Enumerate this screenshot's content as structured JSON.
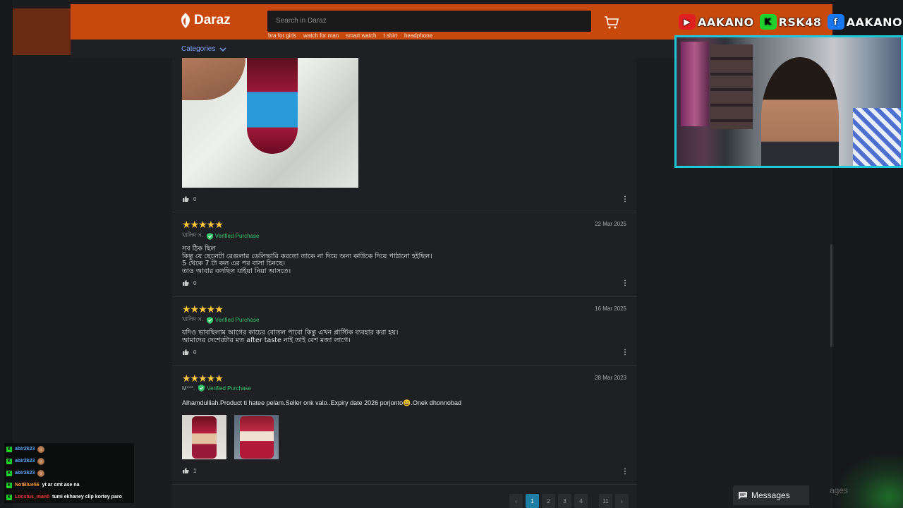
{
  "header": {
    "logo_text": "Daraz",
    "search_placeholder": "Search in Daraz",
    "suggestions": [
      "bra for girls",
      "watch for man",
      "smart watch",
      "t shirt",
      "headphone"
    ],
    "categories_label": "Categories"
  },
  "socials": [
    {
      "platform": "youtube",
      "label": "AAKANO"
    },
    {
      "platform": "kick",
      "label": "RSK48"
    },
    {
      "platform": "facebook",
      "label": "AAKANO"
    }
  ],
  "reviews": [
    {
      "likes": "0"
    },
    {
      "rating": "★★★★★",
      "author": "খালিদ স.",
      "verified": "Verified Purchase",
      "date": "22 Mar 2025",
      "lines": [
        "সব ঠিক ছিল",
        "কিন্তু যে ছেলেটা রেগুলার ডেলিভারি করতো তাকে না দিয়ে অন্য কাউকে দিয়ে পাঠানো হইছিল।",
        "5 থেকে 7 টা কল এর পর বাসা চিনছে।",
        "তাও আবার বলছিল যাইয়া নিয়া আসতে।"
      ],
      "likes": "0"
    },
    {
      "rating": "★★★★★",
      "author": "খালিদ স.",
      "verified": "Verified Purchase",
      "date": "16 Mar 2025",
      "lines": [
        "যদিও ভাবছিলাম আগের কাচের বোতল পাবো কিন্তু এখন প্লাস্টিক ব্যবহার করা হয়।",
        "আমাদের দেশেরটার মত after taste নাই তাই বেশ মজা লাগে।"
      ],
      "likes": "0"
    },
    {
      "rating": "★★★★★",
      "author": "M***.",
      "verified": "Verified Purchase",
      "date": "28 Mar 2023",
      "lines": [
        "Alhamdulliah.Product ti hatee pelam.Seller onk valo..Expiry date 2026 porjonto😃.Onek dhonnobad"
      ],
      "likes": "1"
    }
  ],
  "pagination": {
    "prev": "‹",
    "pages": [
      "1",
      "2",
      "3",
      "4"
    ],
    "gap": "",
    "last": "11",
    "next": "›",
    "active": "1"
  },
  "messages": {
    "label": "Messages",
    "ghost": "ages"
  },
  "chat": [
    {
      "user": "abir2k23",
      "user_color": "#5aa8ff",
      "msg": "",
      "emote": true
    },
    {
      "user": "abir2k23",
      "user_color": "#5aa8ff",
      "msg": "",
      "emote": true
    },
    {
      "user": "abir2k23",
      "user_color": "#5aa8ff",
      "msg": "",
      "emote": true
    },
    {
      "user": "NotBlue56",
      "user_color": "#ff9a3a",
      "msg": "yt ar cmt ase na",
      "emote": false
    },
    {
      "user": "Locstus_man0",
      "user_color": "#ff3a3a",
      "msg": "tumi ekhaney clip kortey paro",
      "emote": false
    }
  ],
  "colors": {
    "brand": "#c9490c",
    "accent_link": "#7ea5ff",
    "verified": "#36c46a",
    "star": "#ffc83a",
    "active_page": "#1f7ea6"
  }
}
